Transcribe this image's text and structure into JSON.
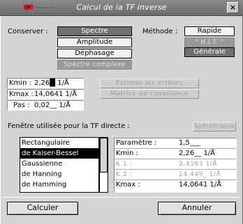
{
  "window": {
    "title": "Calcul de la TF inverse",
    "close_label": "×"
  },
  "conserver": {
    "label": "Conserver :",
    "options": [
      "Spectre",
      "Amplitude",
      "Déphasage",
      "Spectre complexe"
    ],
    "selected": "Spectre"
  },
  "methode": {
    "label": "Méthode :",
    "options": [
      "Rapide",
      "\" H.I.T. \"",
      "Générale"
    ],
    "selected": "Générale"
  },
  "range": {
    "kmin_label": "Kmin :",
    "kmin_value": "2,26█ 1/Å",
    "kmax_label": "Kmax :",
    "kmax_value": "14,0641 1/Å",
    "pas_label": "Pas :",
    "pas_value": "0,02__ 1/Å"
  },
  "actions": {
    "estimer": "Estimer les erreurs",
    "matrice": "Matrice de covariance"
  },
  "fenetre": {
    "label": "Fenêtre utilisée pour la TF directe :",
    "button": "Symétrique",
    "items": [
      "Rectangulaire",
      "de Kaiser-Bessel",
      "Gaussienne",
      "de Hanning",
      "de Hamming"
    ],
    "selected": "de Kaiser-Bessel"
  },
  "params": {
    "rows": [
      {
        "key": "Paramètre :",
        "value": "1,5___"
      },
      {
        "key": "Kmin       :",
        "value": "2,26__ 1/Å"
      },
      {
        "key": "K 1        :",
        "value": "2.4163 1/Å"
      },
      {
        "key": "K 2        :",
        "value": "14.449_ 1/Å"
      },
      {
        "key": "Kmax       :",
        "value": "14,0641 1/Å"
      }
    ]
  },
  "footer": {
    "calculer": "Calculer",
    "annuler": "Annuler"
  }
}
